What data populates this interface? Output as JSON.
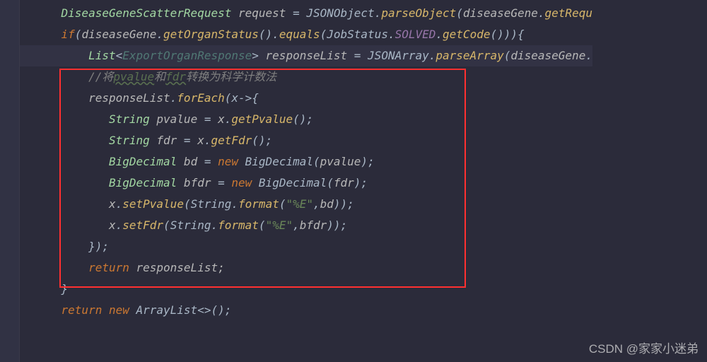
{
  "code": {
    "line1_type": "DiseaseGeneScatterRequest",
    "line1_var": "request",
    "line1_eq": " = ",
    "line1_class": "JSONObject",
    "line1_dot": ".",
    "line1_method": "parseObject",
    "line1_open": "(",
    "line1_arg": "diseaseGene",
    "line1_dot2": ".",
    "line1_method2": "getRequ",
    "line2_if": "if",
    "line2_open": "(",
    "line2_var": "diseaseGene",
    "line2_dot": ".",
    "line2_method": "getOrganStatus",
    "line2_parens": "()",
    "line2_dot2": ".",
    "line2_equals": "equals",
    "line2_open2": "(",
    "line2_class": "JobStatus",
    "line2_dot3": ".",
    "line2_static": "SOLVED",
    "line2_dot4": ".",
    "line2_method2": "getCode",
    "line2_close": "())){",
    "line3_type": "List",
    "line3_lt": "<",
    "line3_gen": "ExportOrganResponse",
    "line3_gt": ">",
    "line3_var": " responseList",
    "line3_eq": " = ",
    "line3_class": "JSONArray",
    "line3_dot": ".",
    "line3_method": "parseArray",
    "line3_open": "(",
    "line3_arg": "diseaseGene",
    "line3_dot2": ".",
    "line4_comment_prefix": "//将",
    "line4_comment_pvalue": "pvalue",
    "line4_comment_mid": "和",
    "line4_comment_fdr": "fdr",
    "line4_comment_suffix": "转换为科学计数法",
    "line5_var": "responseList",
    "line5_dot": ".",
    "line5_method": "forEach",
    "line5_open": "(",
    "line5_param": "x",
    "line5_arrow": "->{",
    "line6_type": "String",
    "line6_var": " pvalue",
    "line6_eq": " = ",
    "line6_x": "x",
    "line6_dot": ".",
    "line6_method": "getPvalue",
    "line6_close": "();",
    "line7_type": "String",
    "line7_var": " fdr",
    "line7_eq": " = ",
    "line7_x": "x",
    "line7_dot": ".",
    "line7_method": "getFdr",
    "line7_close": "();",
    "line8_type": "BigDecimal",
    "line8_var": " bd",
    "line8_eq": " = ",
    "line8_new": "new",
    "line8_space": " ",
    "line8_class": "BigDecimal",
    "line8_open": "(",
    "line8_arg": "pvalue",
    "line8_close": ");",
    "line9_type": "BigDecimal",
    "line9_var": " bfdr",
    "line9_eq": " = ",
    "line9_new": "new",
    "line9_space": " ",
    "line9_class": "BigDecimal",
    "line9_open": "(",
    "line9_arg": "fdr",
    "line9_close": ");",
    "line10_x": "x",
    "line10_dot": ".",
    "line10_method": "setPvalue",
    "line10_open": "(",
    "line10_class": "String",
    "line10_dot2": ".",
    "line10_format": "format",
    "line10_open2": "(",
    "line10_str": "\"%E\"",
    "line10_comma": ",",
    "line10_arg": "bd",
    "line10_close": "));",
    "line11_x": "x",
    "line11_dot": ".",
    "line11_method": "setFdr",
    "line11_open": "(",
    "line11_class": "String",
    "line11_dot2": ".",
    "line11_format": "format",
    "line11_open2": "(",
    "line11_str": "\"%E\"",
    "line11_comma": ",",
    "line11_arg": "bfdr",
    "line11_close": "));",
    "line12_close": "});",
    "line14_return": "return",
    "line14_var": " responseList;",
    "line15_close": "}",
    "line16_return": "return",
    "line16_new": " new",
    "line16_class": " ArrayList",
    "line16_diamond": "<>();",
    "blank": ""
  },
  "watermark": "CSDN @家家小迷弟"
}
